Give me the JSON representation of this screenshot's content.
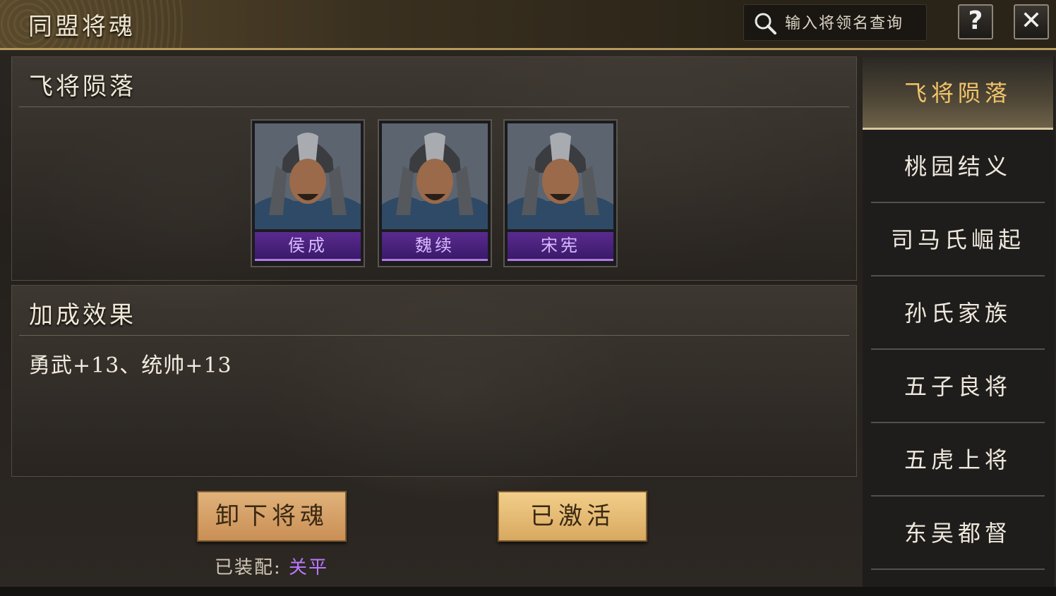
{
  "header": {
    "title": "同盟将魂",
    "search_placeholder": "输入将领名查询",
    "help_label": "?",
    "close_label": "✕"
  },
  "set_panel": {
    "title": "飞将陨落",
    "generals": [
      {
        "name": "侯成"
      },
      {
        "name": "魏续"
      },
      {
        "name": "宋宪"
      }
    ]
  },
  "bonus_panel": {
    "title": "加成效果",
    "effect": "勇武+13、统帅+13"
  },
  "actions": {
    "unequip_label": "卸下将魂",
    "activated_label": "已激活",
    "equipped_label": "已装配:",
    "equipped_value": "关平"
  },
  "sidebar": {
    "items": [
      {
        "label": "飞将陨落",
        "active": true
      },
      {
        "label": "桃园结义"
      },
      {
        "label": "司马氏崛起"
      },
      {
        "label": "孙氏家族"
      },
      {
        "label": "五子良将"
      },
      {
        "label": "五虎上将"
      },
      {
        "label": "东吴都督"
      }
    ]
  },
  "colors": {
    "accent_gold": "#f2c46a",
    "rarity_purple": "#b878ff",
    "button_tan": "#d8a860"
  }
}
